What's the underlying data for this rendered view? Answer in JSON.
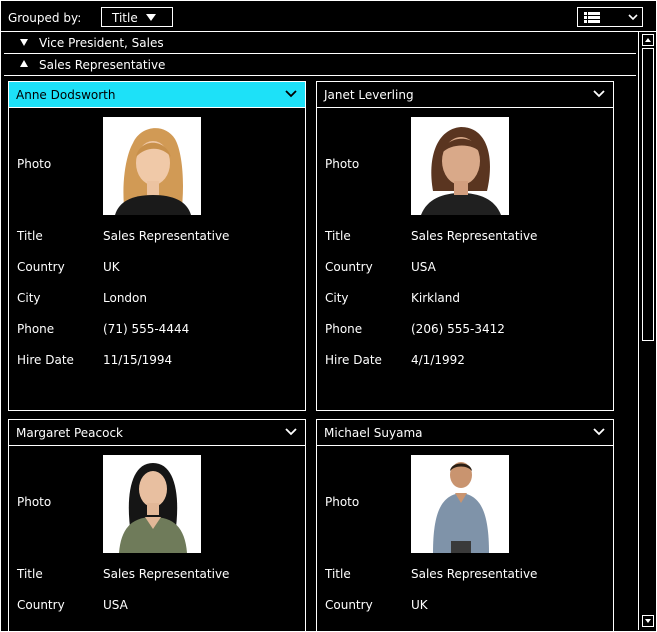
{
  "toolbar": {
    "grouped_by_label": "Grouped by:",
    "grouped_by_value": "Title",
    "view_icon": "list-view-icon"
  },
  "groups": [
    {
      "label": "Vice President, Sales",
      "expanded": false
    },
    {
      "label": "Sales Representative",
      "expanded": true
    }
  ],
  "field_labels": {
    "photo": "Photo",
    "title": "Title",
    "country": "Country",
    "city": "City",
    "phone": "Phone",
    "hire_date": "Hire Date"
  },
  "employees": [
    {
      "name": "Anne Dodsworth",
      "selected": true,
      "title": "Sales Representative",
      "country": "UK",
      "city": "London",
      "phone": "(71) 555-4444",
      "hire_date": "11/15/1994"
    },
    {
      "name": "Janet Leverling",
      "selected": false,
      "title": "Sales Representative",
      "country": "USA",
      "city": "Kirkland",
      "phone": "(206) 555-3412",
      "hire_date": "4/1/1992"
    },
    {
      "name": "Margaret Peacock",
      "selected": false,
      "title": "Sales Representative",
      "country": "USA"
    },
    {
      "name": "Michael Suyama",
      "selected": false,
      "title": "Sales Representative",
      "country": "UK"
    }
  ],
  "colors": {
    "background": "#000000",
    "foreground": "#ffffff",
    "selected_header": "#1de1f8"
  }
}
